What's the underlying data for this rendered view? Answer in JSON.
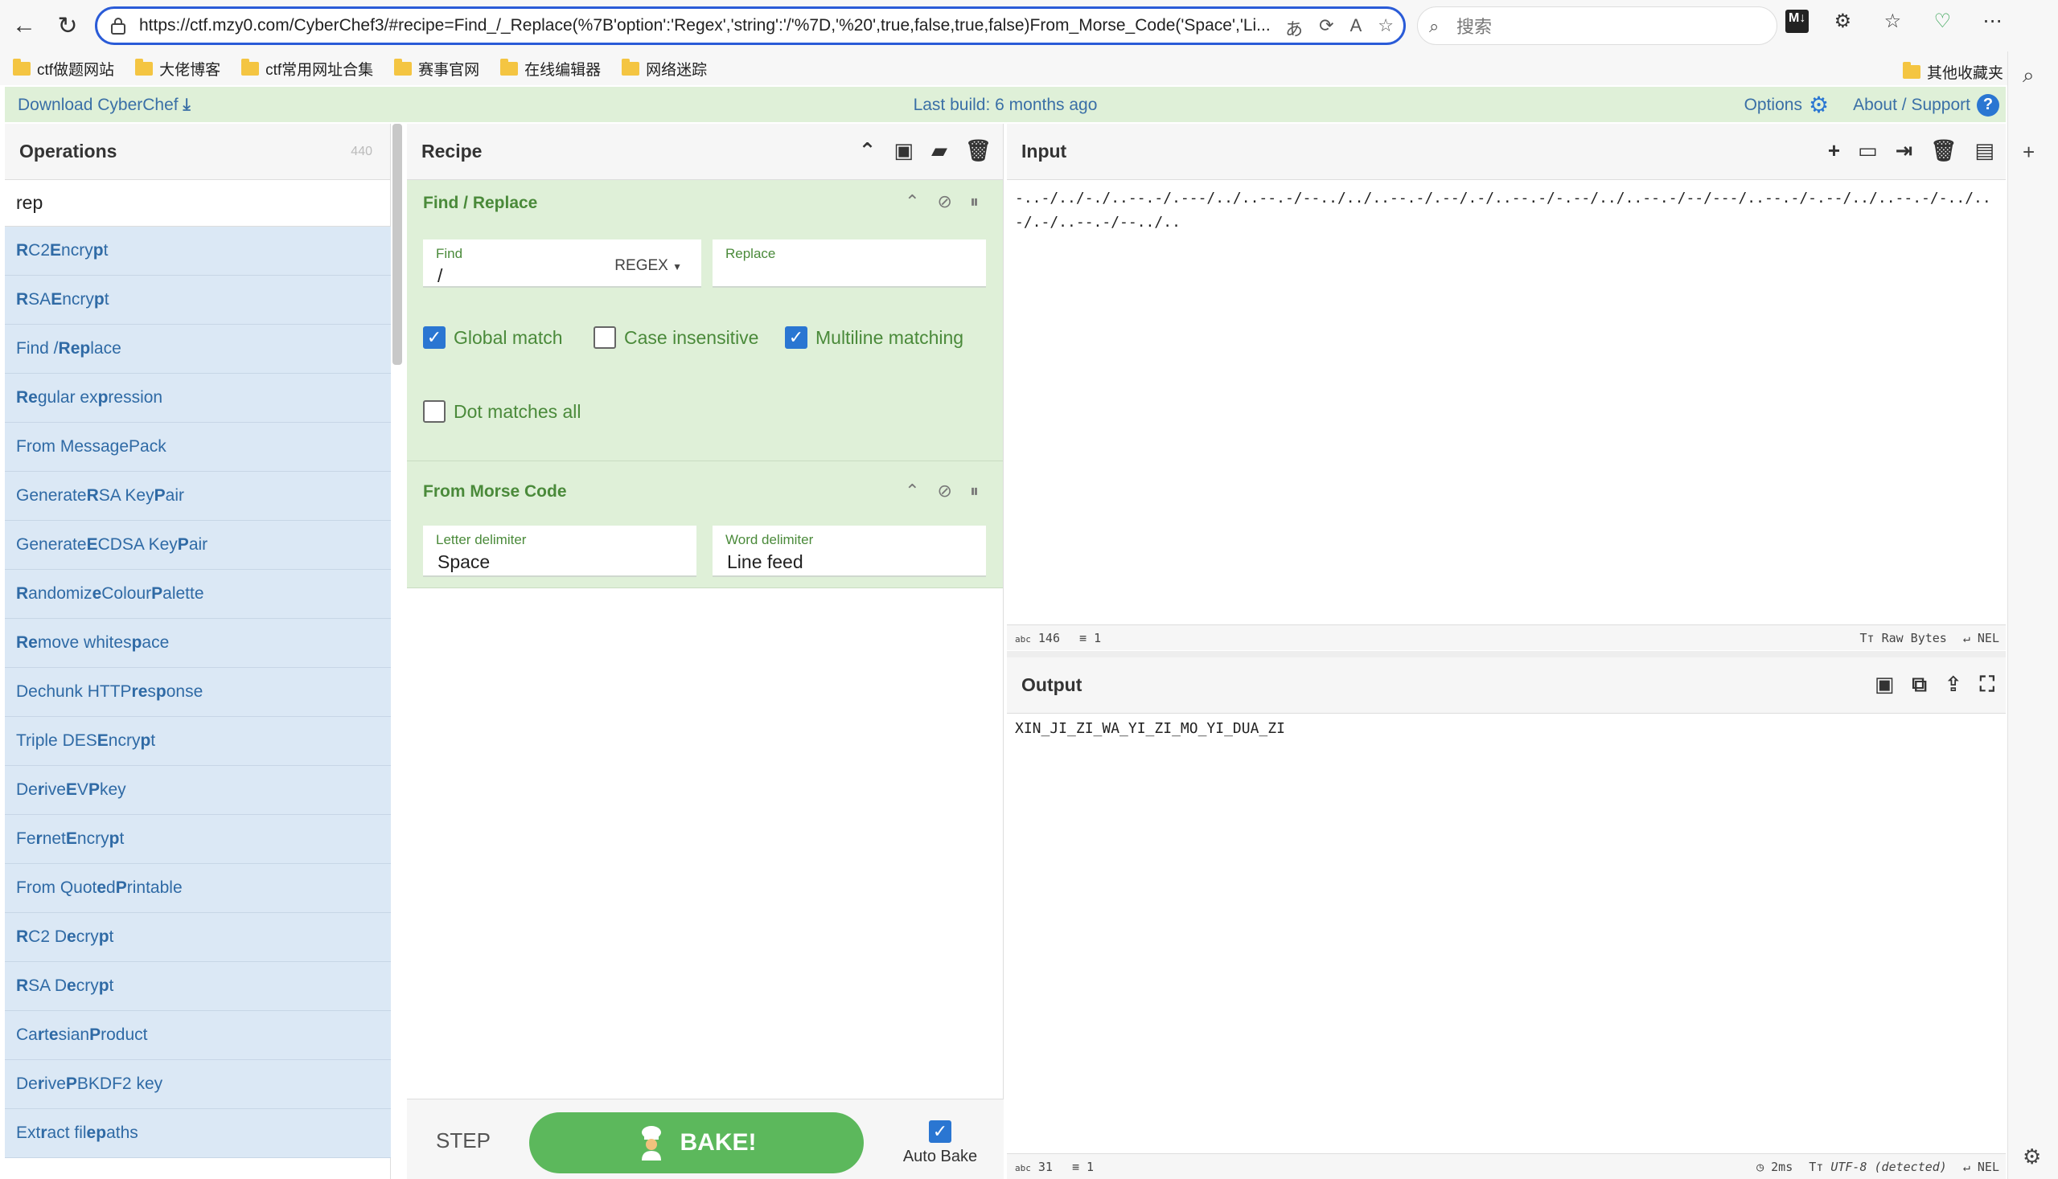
{
  "browser": {
    "url": "https://ctf.mzy0.com/CyberChef3/#recipe=Find_/_Replace(%7B'option':'Regex','string':'/'%7D,'%20',true,false,true,false)From_Morse_Code('Space','Li...",
    "search_placeholder": "搜索",
    "bookmarks": [
      "ctf做题网站",
      "大佬博客",
      "ctf常用网址合集",
      "赛事官网",
      "在线编辑器",
      "网络迷踪"
    ],
    "bookmarks_other": "其他收藏夹"
  },
  "banner": {
    "download": "Download CyberChef",
    "last_build": "Last build: 6 months ago",
    "options": "Options",
    "about": "About / Support"
  },
  "operations": {
    "title": "Operations",
    "count": "440",
    "search_value": "rep",
    "items": [
      {
        "pre": "",
        "b": "R",
        "mid": "C2 ",
        "b2": "E",
        "post": "ncry",
        "b3": "p",
        "end": "t"
      },
      {
        "pre": "",
        "b": "R",
        "mid": "SA ",
        "b2": "E",
        "post": "ncry",
        "b3": "p",
        "end": "t"
      },
      {
        "pre": "Find / ",
        "b": "Rep",
        "mid": "lace",
        "b2": "",
        "post": "",
        "b3": "",
        "end": ""
      },
      {
        "pre": "",
        "b": "Re",
        "mid": "gular ex",
        "b2": "p",
        "post": "ression",
        "b3": "",
        "end": ""
      },
      {
        "pre": "From MessageP",
        "b": "",
        "mid": "ack",
        "b2": "",
        "post": "",
        "b3": "",
        "end": ""
      },
      {
        "pre": "Generate ",
        "b": "R",
        "mid": "SA Key ",
        "b2": "P",
        "post": "air",
        "b3": "",
        "end": ""
      },
      {
        "pre": "Generate ",
        "b": "E",
        "mid": "CDSA Key ",
        "b2": "P",
        "post": "air",
        "b3": "",
        "end": ""
      },
      {
        "pre": "",
        "b": "R",
        "mid": "andomiz",
        "b2": "e",
        "post": " Colour ",
        "b3": "P",
        "end": "alette"
      },
      {
        "pre": "",
        "b": "Re",
        "mid": "move whites",
        "b2": "p",
        "post": "ace",
        "b3": "",
        "end": ""
      },
      {
        "pre": "Dechunk HTTP ",
        "b": "re",
        "mid": "s",
        "b2": "p",
        "post": "onse",
        "b3": "",
        "end": ""
      },
      {
        "pre": "Triple DES ",
        "b": "E",
        "mid": "ncry",
        "b2": "p",
        "post": "t",
        "b3": "",
        "end": ""
      },
      {
        "pre": "De",
        "b": "r",
        "mid": "ive ",
        "b2": "E",
        "post": "V",
        "b3": "P",
        "end": " key"
      },
      {
        "pre": "Fe",
        "b": "r",
        "mid": "net ",
        "b2": "E",
        "post": "ncry",
        "b3": "p",
        "end": "t"
      },
      {
        "pre": "From Quot",
        "b": "e",
        "mid": "d ",
        "b2": "P",
        "post": "rintable",
        "b3": "",
        "end": ""
      },
      {
        "pre": "",
        "b": "R",
        "mid": "C2 D",
        "b2": "e",
        "post": "cry",
        "b3": "p",
        "end": "t"
      },
      {
        "pre": "",
        "b": "R",
        "mid": "SA D",
        "b2": "e",
        "post": "cry",
        "b3": "p",
        "end": "t"
      },
      {
        "pre": "Ca",
        "b": "r",
        "mid": "t",
        "b2": "e",
        "post": "sian ",
        "b3": "P",
        "end": "roduct"
      },
      {
        "pre": "De",
        "b": "r",
        "mid": "ive ",
        "b2": "P",
        "post": "BKDF2 key",
        "b3": "",
        "end": ""
      },
      {
        "pre": "Ext",
        "b": "r",
        "mid": "act fil",
        "b2": "e",
        "post": " ",
        "b3": "p",
        "end": "aths"
      }
    ]
  },
  "recipe": {
    "title": "Recipe",
    "find_replace": {
      "title": "Find / Replace",
      "find_label": "Find",
      "find_value": "/",
      "find_mode": "REGEX",
      "replace_label": "Replace",
      "replace_value": "",
      "global_match": "Global match",
      "case_insensitive": "Case insensitive",
      "multiline": "Multiline matching",
      "dot_all": "Dot matches all"
    },
    "morse": {
      "title": "From Morse Code",
      "letter_label": "Letter delimiter",
      "letter_value": "Space",
      "word_label": "Word delimiter",
      "word_value": "Line feed"
    },
    "step": "STEP",
    "bake": "BAKE!",
    "auto_bake": "Auto Bake"
  },
  "input": {
    "title": "Input",
    "text": "-..-/../-./..--.-/.---/../..--.-/--../../..--.-/.--/.-/..--.-/-.--/../..--.-/--/---/..--.-/-.--/../..--.-/-../..-/.-/..--.-/--../..",
    "chars": "146",
    "lines": "1",
    "format": "Raw Bytes",
    "eol": "NEL"
  },
  "output": {
    "title": "Output",
    "text": "XIN_JI_ZI_WA_YI_ZI_MO_YI_DUA_ZI",
    "chars": "31",
    "lines": "1",
    "time": "2ms",
    "encoding": "UTF-8 (detected)",
    "eol": "NEL"
  }
}
